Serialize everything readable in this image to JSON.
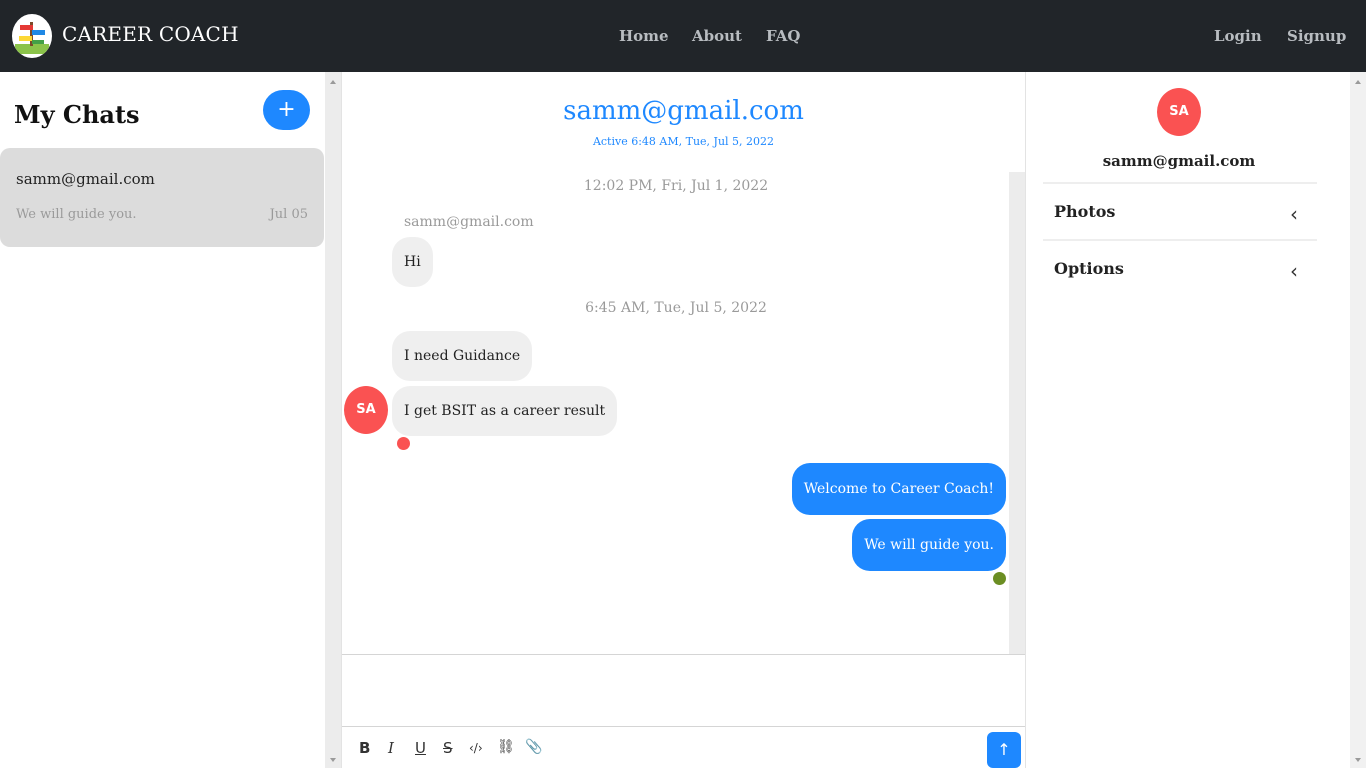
{
  "nav": {
    "brand": "CAREER COACH",
    "links": [
      "Home",
      "About",
      "FAQ"
    ],
    "login": "Login",
    "signup": "Signup"
  },
  "sidebar": {
    "title": "My Chats",
    "add_label": "+",
    "chats": [
      {
        "name": "samm@gmail.com",
        "last_message": "We will guide you.",
        "date": "Jul 05"
      }
    ]
  },
  "chat": {
    "title": "samm@gmail.com",
    "active": "Active 6:48 AM, Tue, Jul 5, 2022",
    "timestamps": [
      "12:02 PM, Fri, Jul 1, 2022",
      "6:45 AM, Tue, Jul 5, 2022"
    ],
    "sender": "samm@gmail.com",
    "avatar_initials": "SA",
    "messages_in": [
      "Hi",
      "I need Guidance",
      "I get BSIT as a career result"
    ],
    "messages_out": [
      "Welcome to Career Coach!",
      "We will guide you."
    ]
  },
  "composer": {
    "tools": [
      "B",
      "I",
      "U",
      "S",
      "‹/›",
      "⛓",
      "📎"
    ],
    "send_icon": "↑"
  },
  "profile": {
    "initials": "SA",
    "email": "samm@gmail.com",
    "sections": [
      "Photos",
      "Options"
    ],
    "chevron": "‹"
  },
  "colors": {
    "accent": "#1e88ff",
    "avatar": "#fa5252",
    "nav_bg": "#212529",
    "read_dot_in": "#fa5252",
    "read_dot_out": "#6b8e23"
  },
  "icons": [
    "logo-icon",
    "plus-icon",
    "bold-icon",
    "italic-icon",
    "underline-icon",
    "strikethrough-icon",
    "code-icon",
    "link-icon",
    "attachment-icon",
    "send-arrow-icon",
    "chevron-left-icon"
  ]
}
